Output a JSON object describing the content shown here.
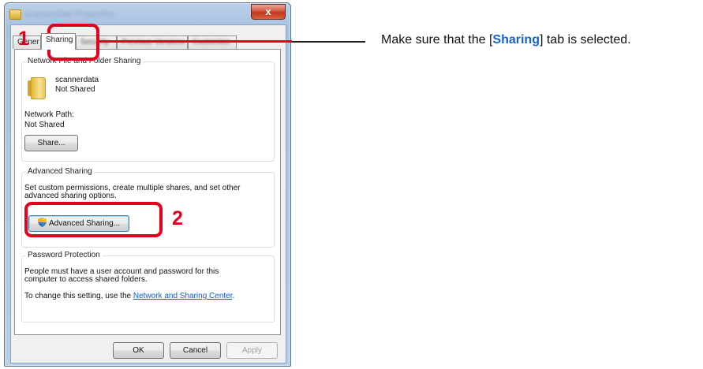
{
  "window": {
    "title": "scannerdata Properties",
    "close_label": "x"
  },
  "tabs": [
    {
      "label": "General",
      "visible_text": "Gener"
    },
    {
      "label": "Sharing"
    },
    {
      "label": "Security"
    },
    {
      "label": "Previous Versions"
    },
    {
      "label": "Customize"
    }
  ],
  "network_sharing": {
    "legend": "Network File and Folder Sharing",
    "folder_name": "scannerdata",
    "folder_status": "Not Shared",
    "path_label": "Network Path:",
    "path_value": "Not Shared",
    "share_button": "Share..."
  },
  "advanced_sharing": {
    "legend": "Advanced Sharing",
    "description_line1": "Set custom permissions, create multiple shares, and set other",
    "description_line2": "advanced sharing options.",
    "button": "Advanced Sharing..."
  },
  "password_protection": {
    "legend": "Password Protection",
    "line1": "People must have a user account and password for this",
    "line2": "computer to access shared folders.",
    "line3_prefix": "To change this setting, use the ",
    "link": "Network and Sharing Center",
    "line3_suffix": "."
  },
  "footer": {
    "ok": "OK",
    "cancel": "Cancel",
    "apply": "Apply"
  },
  "callouts": {
    "step1": "1",
    "step2": "2",
    "instruction_prefix": "Make sure that the [",
    "instruction_keyword": "Sharing",
    "instruction_suffix": "] tab is selected.",
    "accent_color": "#e3001b",
    "keyword_color": "#1463c9"
  }
}
